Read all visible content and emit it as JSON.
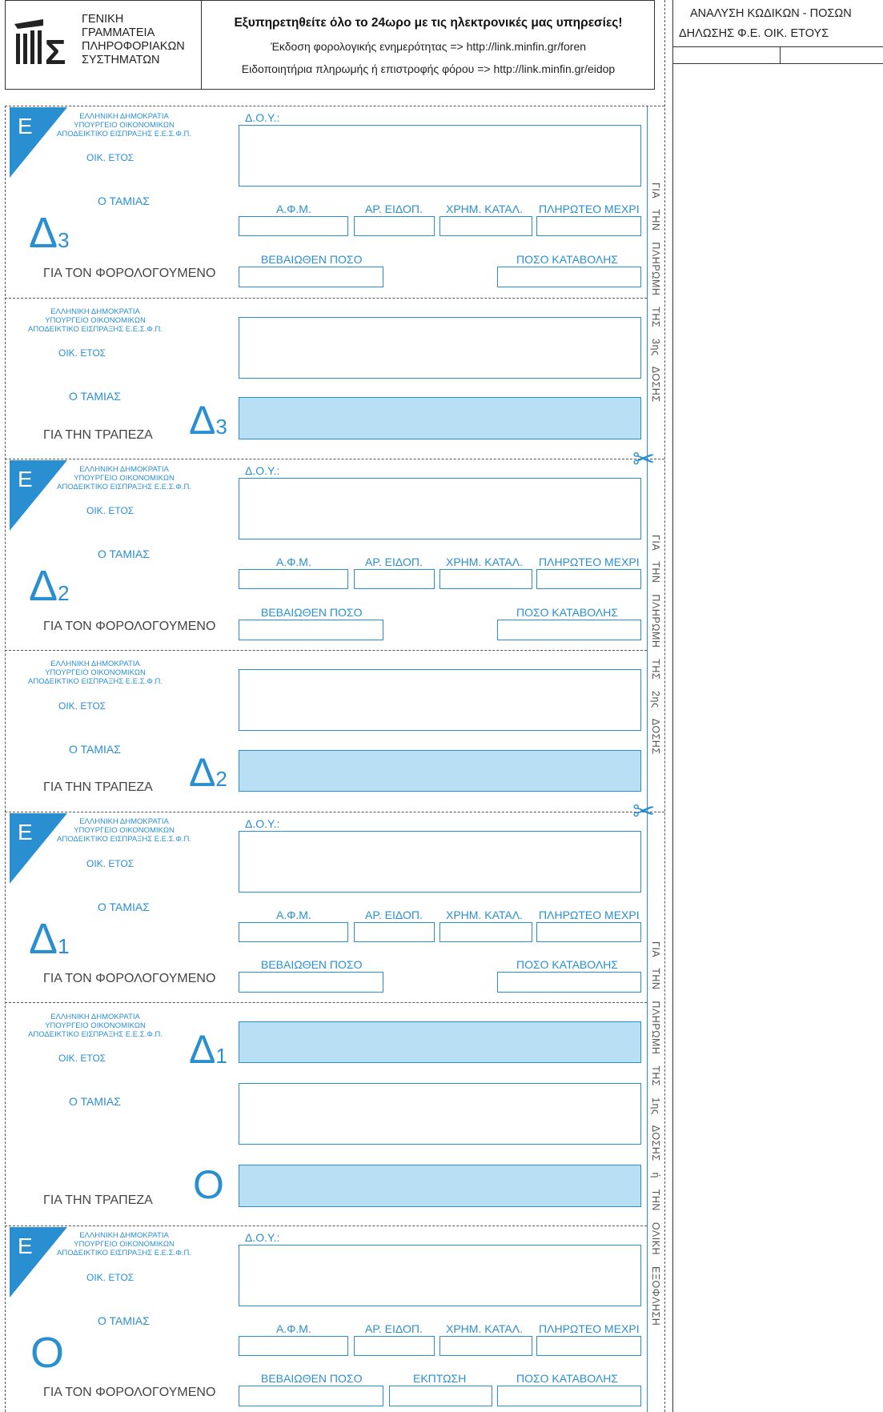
{
  "header": {
    "org_lines": [
      "ΓΕΝΙΚΗ",
      "ΓΡΑΜΜΑΤΕΙΑ",
      "ΠΛΗΡΟΦΟΡΙΑΚΩΝ",
      "ΣΥΣΤΗΜΑΤΩΝ"
    ],
    "promo_title": "Εξυπηρετηθείτε όλο το 24ωρο με τις ηλεκτρονικές μας υπηρεσίες!",
    "promo_line1": "Έκδοση φορολογικής ενημερότητας => http://link.minfin.gr/foren",
    "promo_line2": "Ειδοποιητήρια πληρωμής ή επιστροφής φόρου => http://link.minfin.gr/eidop"
  },
  "side_panel": {
    "title_line1": "ΑΝΑΛΥΣΗ ΚΩΔΙΚΩΝ - ΠΟΣΩΝ",
    "title_line2": "ΔΗΛΩΣΗΣ Φ.Ε. ΟΙΚ. ΕΤΟΥΣ"
  },
  "labels": {
    "triangle_letter": "Ε",
    "gov_line1": "ΕΛΛΗΝΙΚΗ ΔΗΜΟΚΡΑΤΙΑ",
    "gov_line2": "ΥΠΟΥΡΓΕΙΟ ΟΙΚΟΝΟΜΙΚΩΝ",
    "gov_line3": "ΑΠΟΔΕΙΚΤΙΚΟ ΕΙΣΠΡΑΞΗΣ Ε.Ε.Σ.Φ.Π.",
    "oik_etos": "ΟΙΚ. ΕΤΟΣ",
    "tamias": "Ο ΤΑΜΙΑΣ",
    "doy": "Δ.Ο.Υ.:",
    "afm": "Α.Φ.Μ.",
    "ar_eidop": "ΑΡ. ΕΙΔΟΠ.",
    "xrhm_katal": "ΧΡΗΜ. ΚΑΤΑΛ.",
    "plhroteo": "ΠΛΗΡΩΤΕΟ ΜΕΧΡΙ",
    "bebaiothen": "ΒΕΒΑΙΩΘΕΝ ΠΟΣΟ",
    "poso_katabolhs": "ΠΟΣΟ ΚΑΤΑΒΟΛΗΣ",
    "ekptosh": "ΕΚΠΤΩΣΗ",
    "for_taxpayer": "ΓΙΑ ΤΟΝ ΦΟΡΟΛΟΓΟΥΜΕΝΟ",
    "for_bank": "ΓΙΑ ΤΗΝ ΤΡΑΠΕΖΑ"
  },
  "installments": [
    {
      "mark": "Δ",
      "num": "3",
      "side_text": "ΓΙΑ ΤΗΝ ΠΛΗΡΩΜΗ ΤΗΣ 3ης ΔΟΣΗΣ"
    },
    {
      "mark": "Δ",
      "num": "2",
      "side_text": "ΓΙΑ ΤΗΝ ΠΛΗΡΩΜΗ ΤΗΣ 2ης ΔΟΣΗΣ"
    },
    {
      "mark": "Δ",
      "num": "1",
      "side_text": "ΓΙΑ ΤΗΝ ΠΛΗΡΩΜΗ ΤΗΣ 1ης ΔΟΣΗΣ ή ΤΗΝ ΟΛΙΚΗ ΕΞΟΦΛΗΣΗ"
    }
  ],
  "full_payment_mark": "Ο",
  "icons": {
    "scissors": "scissors-icon",
    "logo": "gsis-logo-icon"
  }
}
